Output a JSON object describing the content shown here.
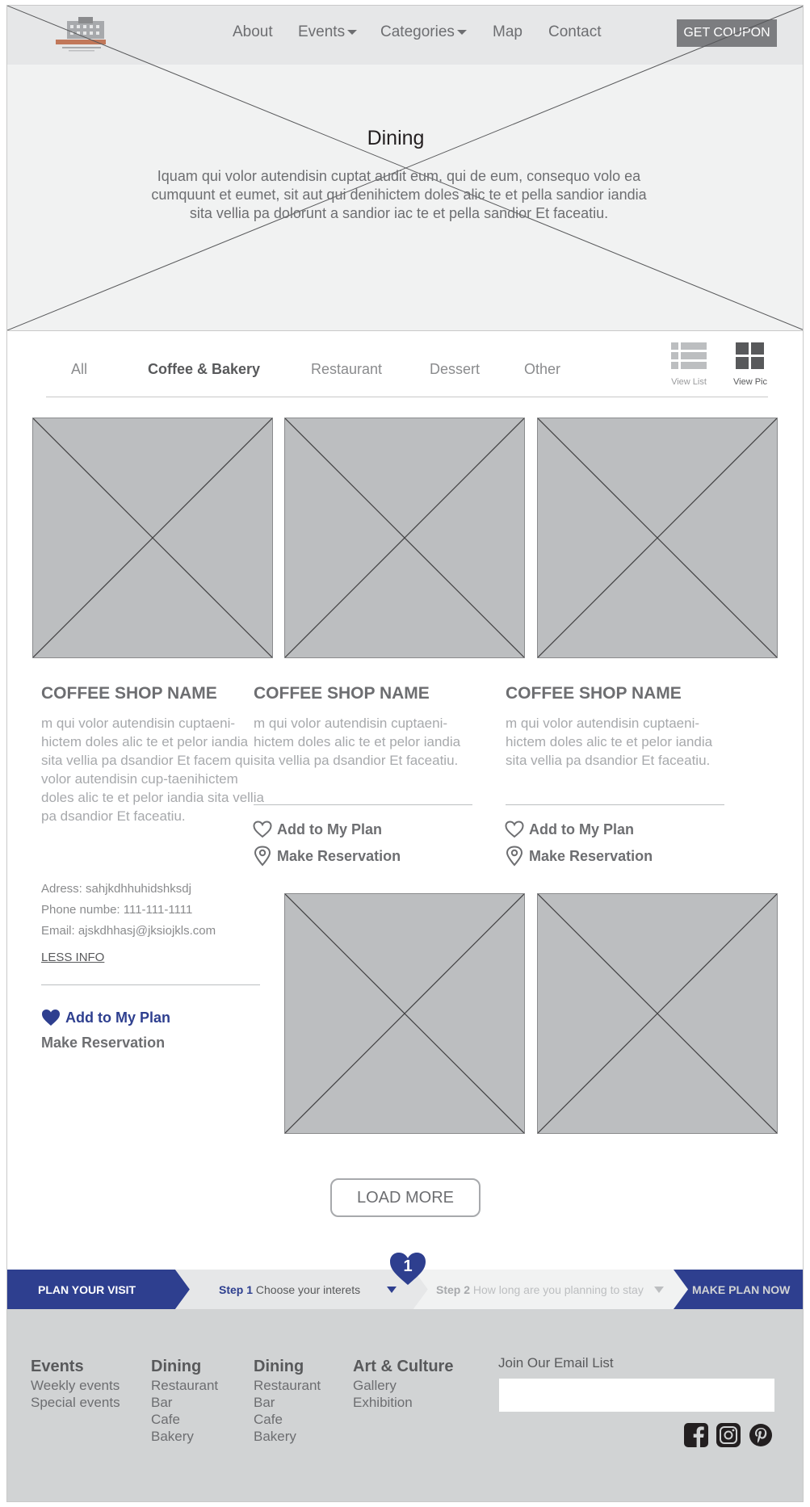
{
  "nav": {
    "about": "About",
    "events": "Events",
    "categories": "Categories",
    "map": "Map",
    "contact": "Contact",
    "coupon": "GET COUPON"
  },
  "hero": {
    "title": "Dining",
    "text": "Iquam qui volor autendisin cuptat audit eum, qui de eum, consequo volo ea cumquunt et eumet, sit aut qui denihictem doles alic te et pella sandior iandia sita vellia pa dolorunt a sandior iac te et pella sandior Et faceatiu."
  },
  "filters": {
    "tabs": [
      "All",
      "Coffee & Bakery",
      "Restaurant",
      "Dessert",
      "Other"
    ],
    "active": "Coffee & Bakery",
    "view_list": "View List",
    "view_pic": "View Pic"
  },
  "cards": [
    {
      "name": "COFFEE SHOP NAME",
      "desc": "m qui volor autendisin cuptaeni-hictem doles alic te et pelor iandia sita vellia pa dsandior Et facem qui volor autendisin cup-taenihictem doles alic te et pelor iandia sita vellia pa dsandior Et faceatiu.",
      "address": "Adress: sahjkdhhuhidshksdj",
      "phone": "Phone numbe: 111-111-1111",
      "email": "Email: ajskdhhasj@jksiojkls.com",
      "less_info": "LESS INFO",
      "add_plan": "Add to My Plan",
      "reservation": "Make Reservation"
    },
    {
      "name": "COFFEE SHOP NAME",
      "desc": "m qui volor autendisin cuptaeni-hictem doles alic te et pelor iandia sita vellia pa dsandior Et faceatiu.",
      "add_plan": "Add to My Plan",
      "reservation": "Make Reservation"
    },
    {
      "name": "COFFEE SHOP NAME",
      "desc": "m qui volor autendisin cuptaeni-hictem doles alic te et pelor iandia sita vellia pa dsandior Et faceatiu.",
      "add_plan": "Add to My Plan",
      "reservation": "Make Reservation"
    }
  ],
  "load_more": "LOAD MORE",
  "plan_bar": {
    "plan_visit": "PLAN YOUR VISIT",
    "step1_label": "Step 1",
    "step1_text": "Choose your interets",
    "step2_label": "Step 2",
    "step2_text": "How long are you planning to stay",
    "make_plan": "MAKE PLAN NOW",
    "badge": "1"
  },
  "footer": {
    "columns": [
      {
        "heading": "Events",
        "links": [
          "Weekly events",
          "Special events"
        ]
      },
      {
        "heading": "Dining",
        "links": [
          "Restaurant",
          "Bar",
          "Cafe",
          "Bakery"
        ]
      },
      {
        "heading": "Dining",
        "links": [
          "Restaurant",
          "Bar",
          "Cafe",
          "Bakery"
        ]
      },
      {
        "heading": "Art & Culture",
        "links": [
          "Gallery",
          "Exhibition"
        ]
      }
    ],
    "email_label": "Join Our Email List",
    "email_placeholder": ""
  },
  "colors": {
    "brand_blue": "#2e3f8f",
    "placeholder_gray": "#bcbec0",
    "footer_bg": "#d1d3d4",
    "coupon_bg": "#7c7d80"
  },
  "icons": [
    "logo-image",
    "list-view-icon",
    "grid-view-icon",
    "heart-outline-icon",
    "heart-filled-icon",
    "location-pin-icon",
    "dropdown-caret-icon",
    "facebook-icon",
    "instagram-icon",
    "pinterest-icon"
  ]
}
